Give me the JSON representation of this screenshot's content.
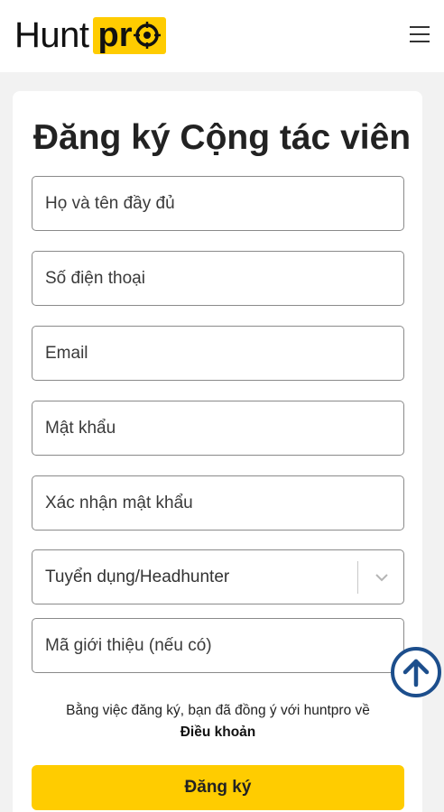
{
  "header": {
    "logo_text_1": "Hunt",
    "logo_text_2": "pr",
    "menu_icon": "hamburger-menu-icon"
  },
  "form": {
    "title": "Đăng ký Cộng tác viên",
    "fields": {
      "full_name_placeholder": "Họ và tên đầy đủ",
      "phone_placeholder": "Số điện thoại",
      "email_placeholder": "Email",
      "password_placeholder": "Mật khẩu",
      "confirm_password_placeholder": "Xác nhận mật khẩu",
      "role_selected": "Tuyển dụng/Headhunter",
      "referral_placeholder": "Mã giới thiệu (nếu có)"
    },
    "terms_text": "Bằng việc đăng ký, bạn đã đồng ý với huntpro về",
    "terms_link": "Điều khoản",
    "submit_label": "Đăng ký"
  },
  "colors": {
    "brand_yellow": "#ffcc00",
    "scroll_button_blue": "#1c4e8c"
  },
  "scroll_top_icon": "arrow-up-circle-icon"
}
